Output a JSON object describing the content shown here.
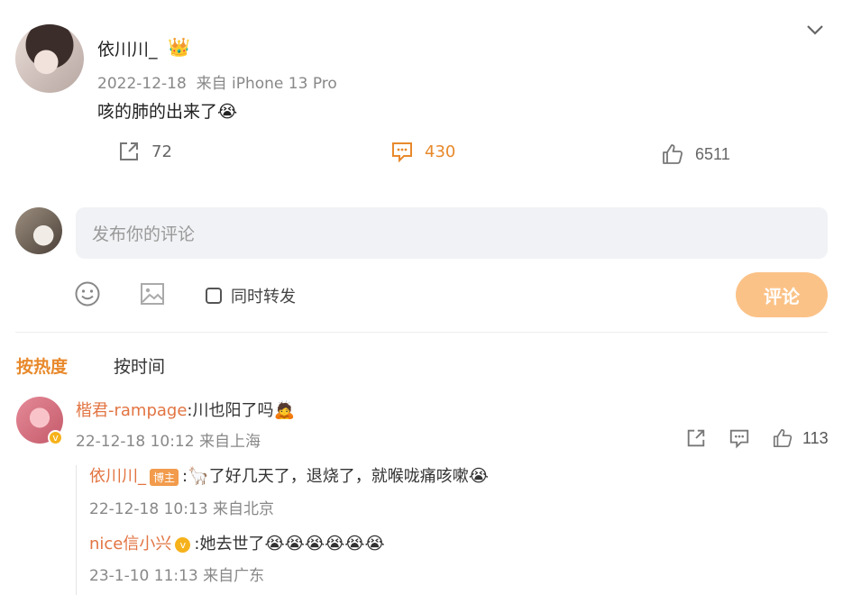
{
  "post": {
    "username": "依川川_",
    "crown_icon": "crown-icon",
    "date": "2022-12-18",
    "source": "来自 iPhone 13 Pro",
    "text": "咳的肺的出来了",
    "text_emoji": "😭",
    "repost_count": "72",
    "comment_count": "430",
    "like_count": "6511"
  },
  "composer": {
    "placeholder": "发布你的评论",
    "also_repost_label": "同时转发",
    "submit_label": "评论"
  },
  "sort": {
    "hot_label": "按热度",
    "time_label": "按时间"
  },
  "comments": [
    {
      "name": "楷君-rampage",
      "text": ":川也阳了吗",
      "emoji": "🙇",
      "meta": "22-12-18 10:12 来自上海",
      "like_count": "113",
      "replies": [
        {
          "name": "依川川_",
          "tag": "博主",
          "text_prefix": ":",
          "lead_emoji": "🦙",
          "text": "了好几天了，退烧了，就喉咙痛咳嗽",
          "emoji": "😭",
          "meta": "22-12-18 10:13 来自北京"
        },
        {
          "name": "nice信小兴",
          "text": ":她去世了",
          "emoji": "😭😭😭😭😭😭",
          "meta": "23-1-10 11:13 来自广东"
        }
      ]
    }
  ],
  "colors": {
    "accent": "#e8892c",
    "name": "#e27442",
    "submit_bg": "#fbc287",
    "input_bg": "#f1f2f5"
  }
}
